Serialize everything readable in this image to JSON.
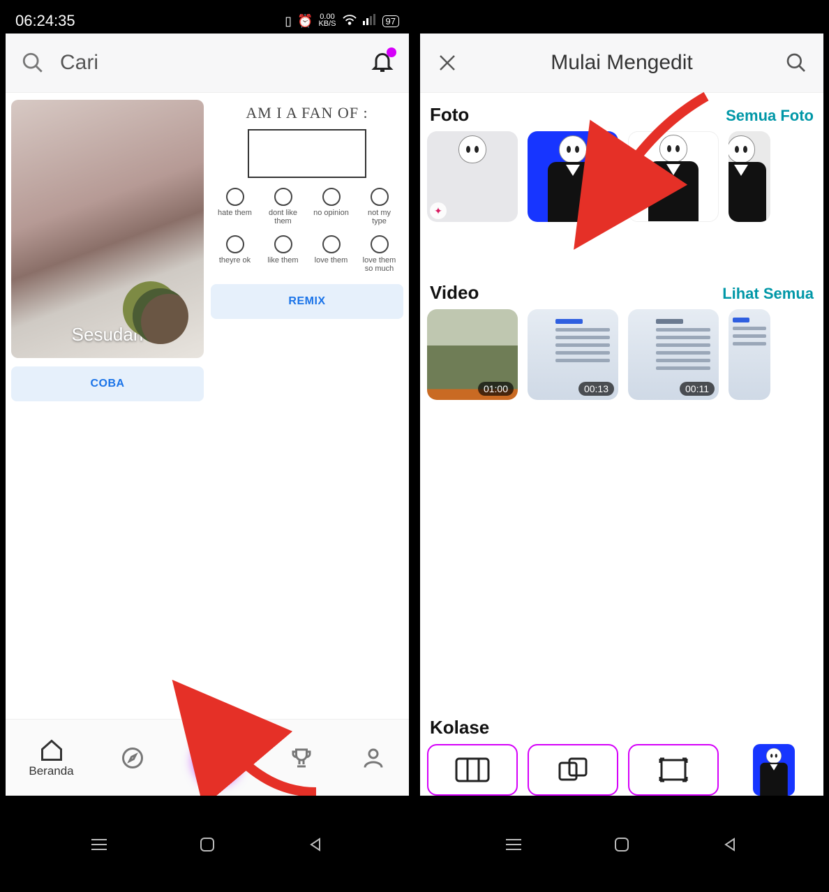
{
  "status": {
    "time": "06:24:35",
    "net_speed": "0.00",
    "net_unit": "KB/S",
    "battery": "97"
  },
  "left": {
    "search_placeholder": "Cari",
    "card1_overlay": "Sesudah",
    "card1_btn": "COBA",
    "quiz_title": "AM I A FAN OF :",
    "quiz_row1": [
      "hate them",
      "dont like them",
      "no opinion",
      "not my type"
    ],
    "quiz_row2": [
      "theyre ok",
      "like them",
      "love them",
      "love them so much"
    ],
    "card2_btn": "REMIX",
    "nav": {
      "home": "Beranda"
    }
  },
  "right": {
    "title": "Mulai Mengedit",
    "sections": {
      "foto": {
        "head": "Foto",
        "link": "Semua Foto"
      },
      "video": {
        "head": "Video",
        "link": "Lihat Semua"
      },
      "kolase": {
        "head": "Kolase"
      }
    },
    "video_durations": [
      "01:00",
      "00:13",
      "00:11"
    ]
  }
}
